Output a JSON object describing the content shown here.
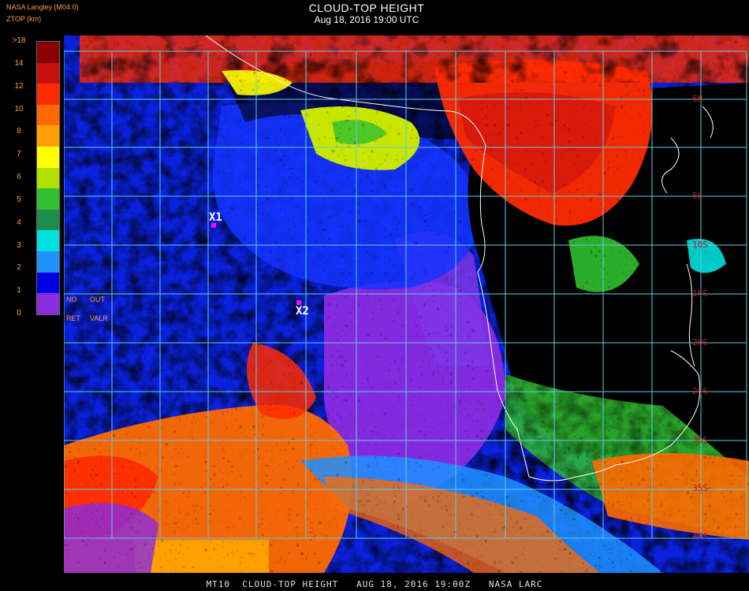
{
  "header": {
    "source": "NASA Langley (M04.0)",
    "product": "ZTOP (km)",
    "title": "CLOUD-TOP HEIGHT",
    "datetime": "Aug 18, 2016 19:00 UTC"
  },
  "legend": {
    "ticks": [
      ">18",
      "14",
      "12",
      "10",
      "8",
      "7",
      "6",
      "5",
      "4",
      "3",
      "2",
      "1",
      "0"
    ],
    "colors": [
      "#8b0000",
      "#c81010",
      "#ff2a00",
      "#ff6a00",
      "#ffa000",
      "#ffff00",
      "#b0e000",
      "#30c030",
      "#1e8c4c",
      "#00e0e0",
      "#1e90ff",
      "#0000e0",
      "#8a2be2"
    ],
    "tick_color": "#ff9a3c"
  },
  "flags": {
    "no": "NO",
    "out": "OUT",
    "ret": "RET",
    "valr": "VALR"
  },
  "markers": [
    {
      "label": "X1",
      "color": "#ff00ff"
    },
    {
      "label": "X2",
      "color": "#ff00ff"
    }
  ],
  "latitudes": [
    "5N",
    "5S",
    "10S",
    "15S",
    "20S",
    "25S",
    "30S",
    "35S",
    "40S"
  ],
  "grid_color": "#5ecfe6",
  "footer": "MT10  CLOUD-TOP HEIGHT   AUG 18, 2016 19:00Z   NASA LARC"
}
